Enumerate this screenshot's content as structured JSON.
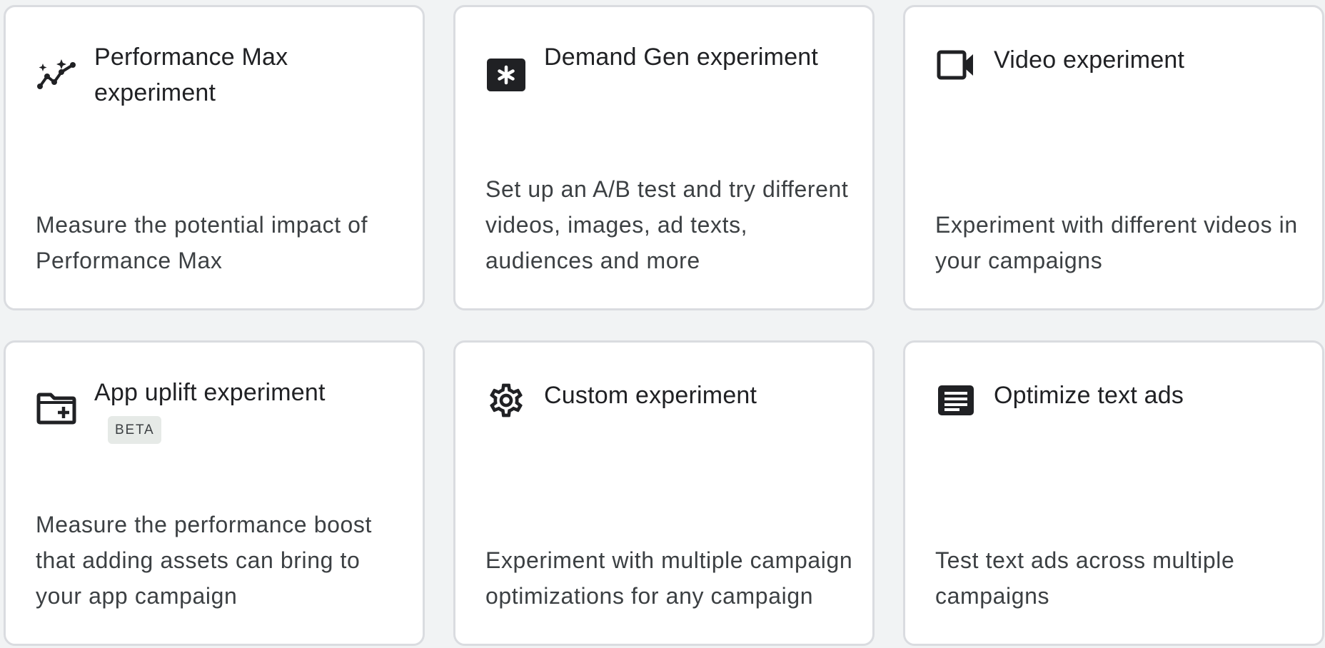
{
  "cards": [
    {
      "icon": "performance-max-icon",
      "title": "Performance Max experiment",
      "description": "Measure the potential impact of Performance Max"
    },
    {
      "icon": "demand-gen-icon",
      "title": "Demand Gen experiment",
      "description": "Set up an A/B test and try different videos, images, ad texts, audiences and more"
    },
    {
      "icon": "videocam-icon",
      "title": "Video experiment",
      "description": "Experiment with different videos in your campaigns"
    },
    {
      "icon": "create-new-folder-icon",
      "title": "App uplift experiment",
      "badge": "BETA",
      "description": "Measure the performance boost that adding assets can bring to your app campaign"
    },
    {
      "icon": "settings-gear-icon",
      "title": "Custom experiment",
      "description": "Experiment with multiple campaign optimizations for any campaign"
    },
    {
      "icon": "text-ads-icon",
      "title": "Optimize text ads",
      "description": "Test text ads across multiple campaigns"
    }
  ],
  "colors": {
    "page_background": "#f1f3f4",
    "card_background": "#ffffff",
    "card_border": "#dadce0",
    "title_text": "#202124",
    "body_text": "#3c4043",
    "badge_background": "#e6eae7"
  }
}
